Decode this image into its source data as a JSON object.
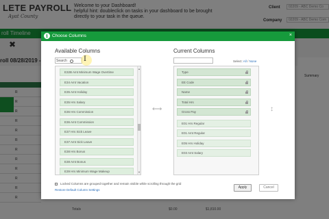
{
  "app": {
    "logo_main": "LETE PAYROLL",
    "logo_sub": "Ayat County",
    "welcome_line1": "Welcome to your Dashboard!",
    "welcome_line2": "helpful hint: doubleclick on tasks in your dashboard to be brought",
    "welcome_line3": "directly to your task in the queue.",
    "client_label": "Client",
    "client_value": "02209 - ABC Demo Co",
    "company_label": "Company",
    "company_value": "02209 - ABC Demo Com",
    "bar_title": "roll Timeline",
    "payroll_label": "roll 08/28/2019 - 1",
    "grid_rows": [
      "R",
      "R",
      "R",
      "R",
      "R",
      "R",
      "R",
      "R",
      "R",
      "R",
      "R",
      "R"
    ],
    "green_block_text": "F\nE\nJ",
    "summary_tab": "Summary",
    "totals_label": "Totals",
    "totals_value1": "$0.00",
    "totals_value2": "$1,810.00"
  },
  "modal": {
    "title": "Choose Columns",
    "close": "×",
    "available": {
      "title": "Available Columns",
      "search_label": "Search",
      "items": [
        "E32B Amt Minimum Wage Overtime",
        "E34 Amt Vacation",
        "E35 Amt Holiday",
        "E35 Hrs Salary",
        "E36 Hrs Commission",
        "E36 Amt Commission",
        "E37 Hrs Sick Leave",
        "E37 Amt Sick Leave",
        "E38 Hrs Bonus",
        "E38 Amt Bonus",
        "E39 Hrs Minimum Wage Makeup"
      ]
    },
    "current": {
      "title": "Current Columns",
      "select_label": "Select:",
      "select_all": "All",
      "select_sep": "/",
      "select_none": "None",
      "locked_items": [
        "Type",
        "EE Code",
        "Name",
        "Total Hrs",
        "Gross Pay"
      ],
      "items": [
        "E01 Hrs Regular",
        "E01 Amt Regular",
        "E05 Hrs Holiday",
        "E03 Amt Salary"
      ]
    },
    "footnote": "Locked Columns are grouped together and remain visible while scrolling through the grid",
    "restore_link": "Restore Default Column Settings",
    "apply_label": "Apply",
    "cancel_label": "Cancel"
  },
  "colors": {
    "brand_green": "#169a3c",
    "item_green": "#ddeedd",
    "link_blue": "#2a6ebb"
  }
}
